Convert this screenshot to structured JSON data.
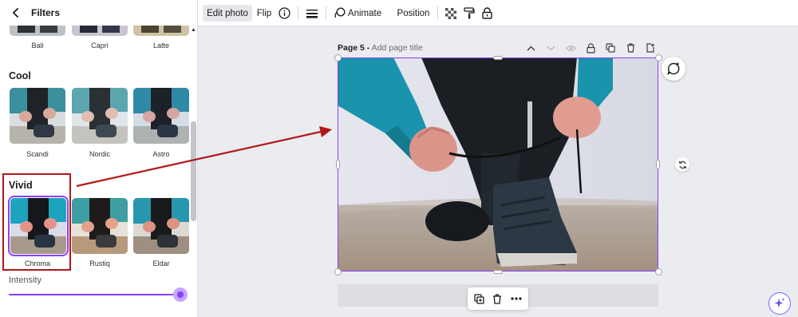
{
  "panel": {
    "title": "Filters",
    "top_row": [
      {
        "label": "Bali"
      },
      {
        "label": "Capri"
      },
      {
        "label": "Latte"
      }
    ],
    "sections": [
      {
        "title": "Cool",
        "items": [
          {
            "label": "Scandi"
          },
          {
            "label": "Nordic"
          },
          {
            "label": "Astro"
          }
        ]
      },
      {
        "title": "Vivid",
        "items": [
          {
            "label": "Chroma"
          },
          {
            "label": "Rustiq"
          },
          {
            "label": "Eldar"
          }
        ]
      }
    ],
    "selected_filter": "Chroma",
    "intensity": {
      "label": "Intensity",
      "value_fraction": 1.0
    }
  },
  "toolbar": {
    "edit_photo": "Edit photo",
    "flip": "Flip",
    "animate": "Animate",
    "position": "Position"
  },
  "page": {
    "name": "Page 5 -",
    "title_placeholder": "Add page title"
  },
  "colors": {
    "accent": "#8b3dff",
    "annotation": "#b01818"
  }
}
